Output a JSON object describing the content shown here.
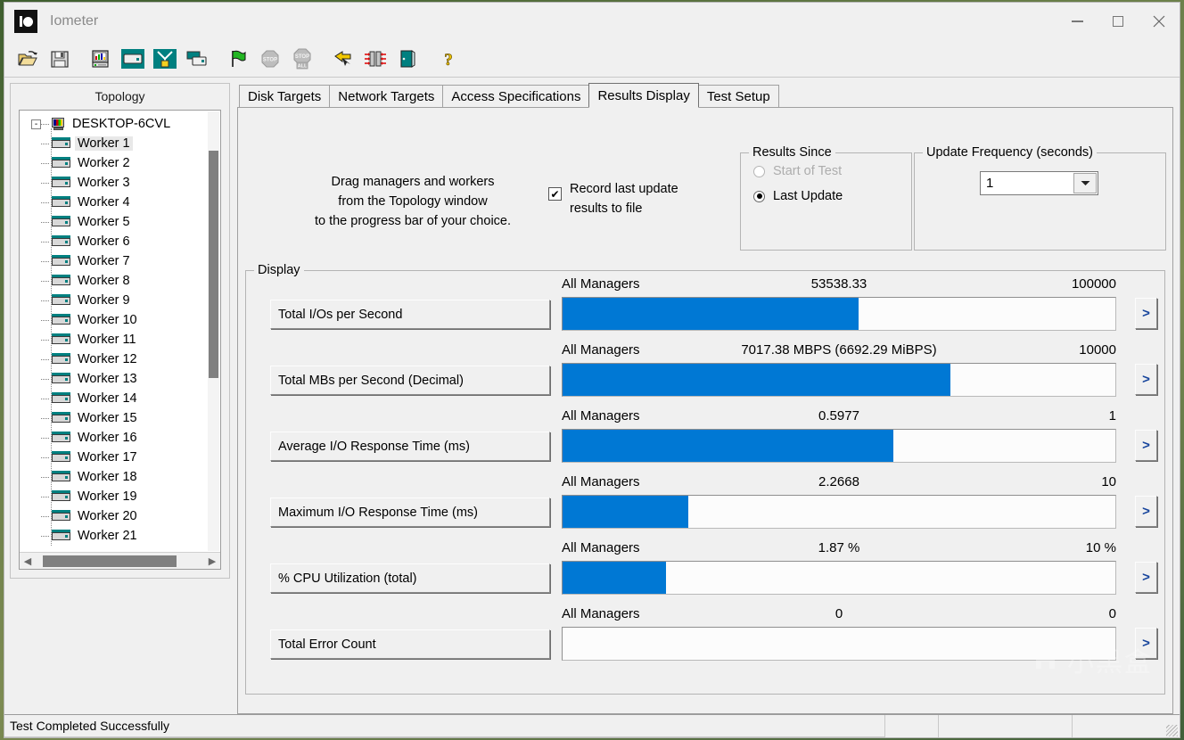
{
  "window": {
    "title": "Iometer",
    "app_icon": "io-logo-icon",
    "minimize_label": "Minimize",
    "maximize_label": "Maximize",
    "close_label": "Close"
  },
  "toolbar": {
    "buttons": [
      {
        "name": "open-config-button",
        "icon": "open-folder-icon",
        "title": "Open test configuration file"
      },
      {
        "name": "save-config-button",
        "icon": "floppy-disk-icon",
        "title": "Save test configuration file"
      },
      {
        "name": "new-manager-button",
        "icon": "computer-monitor-icon",
        "title": "Add new manager"
      },
      {
        "name": "new-worker-button",
        "icon": "disk-drive-icon",
        "title": "Add new worker"
      },
      {
        "name": "new-network-worker-button",
        "icon": "network-fork-icon",
        "title": "Add new network worker"
      },
      {
        "name": "duplicate-worker-button",
        "icon": "duplicate-windows-icon",
        "title": "Duplicate worker"
      },
      {
        "name": "start-tests-button",
        "icon": "green-flag-icon",
        "title": "Start tests"
      },
      {
        "name": "stop-test-button",
        "icon": "stop-sign-icon",
        "title": "Stop current test",
        "disabled": true
      },
      {
        "name": "stop-all-tests-button",
        "icon": "stop-all-sign-icon",
        "title": "Stop all tests",
        "disabled": true
      },
      {
        "name": "reset-button",
        "icon": "yellow-undo-arrow-icon",
        "title": "Reset"
      },
      {
        "name": "swap-button",
        "icon": "swap-arrows-icon",
        "title": "Swap"
      },
      {
        "name": "exit-button",
        "icon": "exit-door-icon",
        "title": "Exit"
      },
      {
        "name": "help-button",
        "icon": "question-mark-icon",
        "title": "Help"
      }
    ]
  },
  "topology": {
    "title": "Topology",
    "root": {
      "label": "DESKTOP-6CVL",
      "expander": "-"
    },
    "workers": [
      {
        "label": "Worker 1",
        "selected": true
      },
      {
        "label": "Worker 2",
        "selected": false
      },
      {
        "label": "Worker 3",
        "selected": false
      },
      {
        "label": "Worker 4",
        "selected": false
      },
      {
        "label": "Worker 5",
        "selected": false
      },
      {
        "label": "Worker 6",
        "selected": false
      },
      {
        "label": "Worker 7",
        "selected": false
      },
      {
        "label": "Worker 8",
        "selected": false
      },
      {
        "label": "Worker 9",
        "selected": false
      },
      {
        "label": "Worker 10",
        "selected": false
      },
      {
        "label": "Worker 11",
        "selected": false
      },
      {
        "label": "Worker 12",
        "selected": false
      },
      {
        "label": "Worker 13",
        "selected": false
      },
      {
        "label": "Worker 14",
        "selected": false
      },
      {
        "label": "Worker 15",
        "selected": false
      },
      {
        "label": "Worker 16",
        "selected": false
      },
      {
        "label": "Worker 17",
        "selected": false
      },
      {
        "label": "Worker 18",
        "selected": false
      },
      {
        "label": "Worker 19",
        "selected": false
      },
      {
        "label": "Worker 20",
        "selected": false
      },
      {
        "label": "Worker 21",
        "selected": false
      }
    ],
    "scroll_left_icon": "triangle-left-icon",
    "scroll_right_icon": "triangle-right-icon"
  },
  "tabs": [
    {
      "label": "Disk Targets",
      "active": false
    },
    {
      "label": "Network Targets",
      "active": false
    },
    {
      "label": "Access Specifications",
      "active": false
    },
    {
      "label": "Results Display",
      "active": true
    },
    {
      "label": "Test Setup",
      "active": false
    }
  ],
  "results_display": {
    "hint_line1": "Drag managers and workers",
    "hint_line2": "from the Topology window",
    "hint_line3": "to the progress bar of your choice.",
    "record_checkbox": {
      "checked": true,
      "check_glyph": "✔",
      "label_line1": "Record last update",
      "label_line2": "results to file"
    },
    "results_since": {
      "title": "Results Since",
      "options": [
        {
          "label": "Start of Test",
          "selected": false,
          "disabled": true
        },
        {
          "label": "Last Update",
          "selected": true,
          "disabled": false
        }
      ]
    },
    "update_frequency": {
      "title": "Update Frequency (seconds)",
      "value": "1",
      "arrow_icon": "chevron-down-icon"
    },
    "display": {
      "title": "Display",
      "expand_glyph": ">",
      "rows": [
        {
          "name": "Total I/Os per Second",
          "manager": "All Managers",
          "value": "53538.33",
          "max": "100000",
          "fill_pct": 53.5
        },
        {
          "name": "Total MBs per Second (Decimal)",
          "manager": "All Managers",
          "value": "7017.38 MBPS (6692.29 MiBPS)",
          "max": "10000",
          "fill_pct": 70.2
        },
        {
          "name": "Average I/O Response Time (ms)",
          "manager": "All Managers",
          "value": "0.5977",
          "max": "1",
          "fill_pct": 59.8
        },
        {
          "name": "Maximum I/O Response Time (ms)",
          "manager": "All Managers",
          "value": "2.2668",
          "max": "10",
          "fill_pct": 22.7
        },
        {
          "name": "% CPU Utilization (total)",
          "manager": "All Managers",
          "value": "1.87 %",
          "max": "10 %",
          "fill_pct": 18.7
        },
        {
          "name": "Total Error Count",
          "manager": "All Managers",
          "value": "0",
          "max": "0",
          "fill_pct": 0
        }
      ]
    }
  },
  "statusbar": {
    "message": "Test Completed Successfully",
    "cell_a": "",
    "cell_b": "",
    "cell_c": "",
    "grip_icon": "resize-grip-icon"
  },
  "watermark": {
    "logo_icon": "xiaoheihe-logo-icon",
    "text": "小黑盒"
  },
  "colors": {
    "accent_blue": "#0078d4",
    "window_bg": "#f0f0f0",
    "teal_icon": "#008080"
  }
}
